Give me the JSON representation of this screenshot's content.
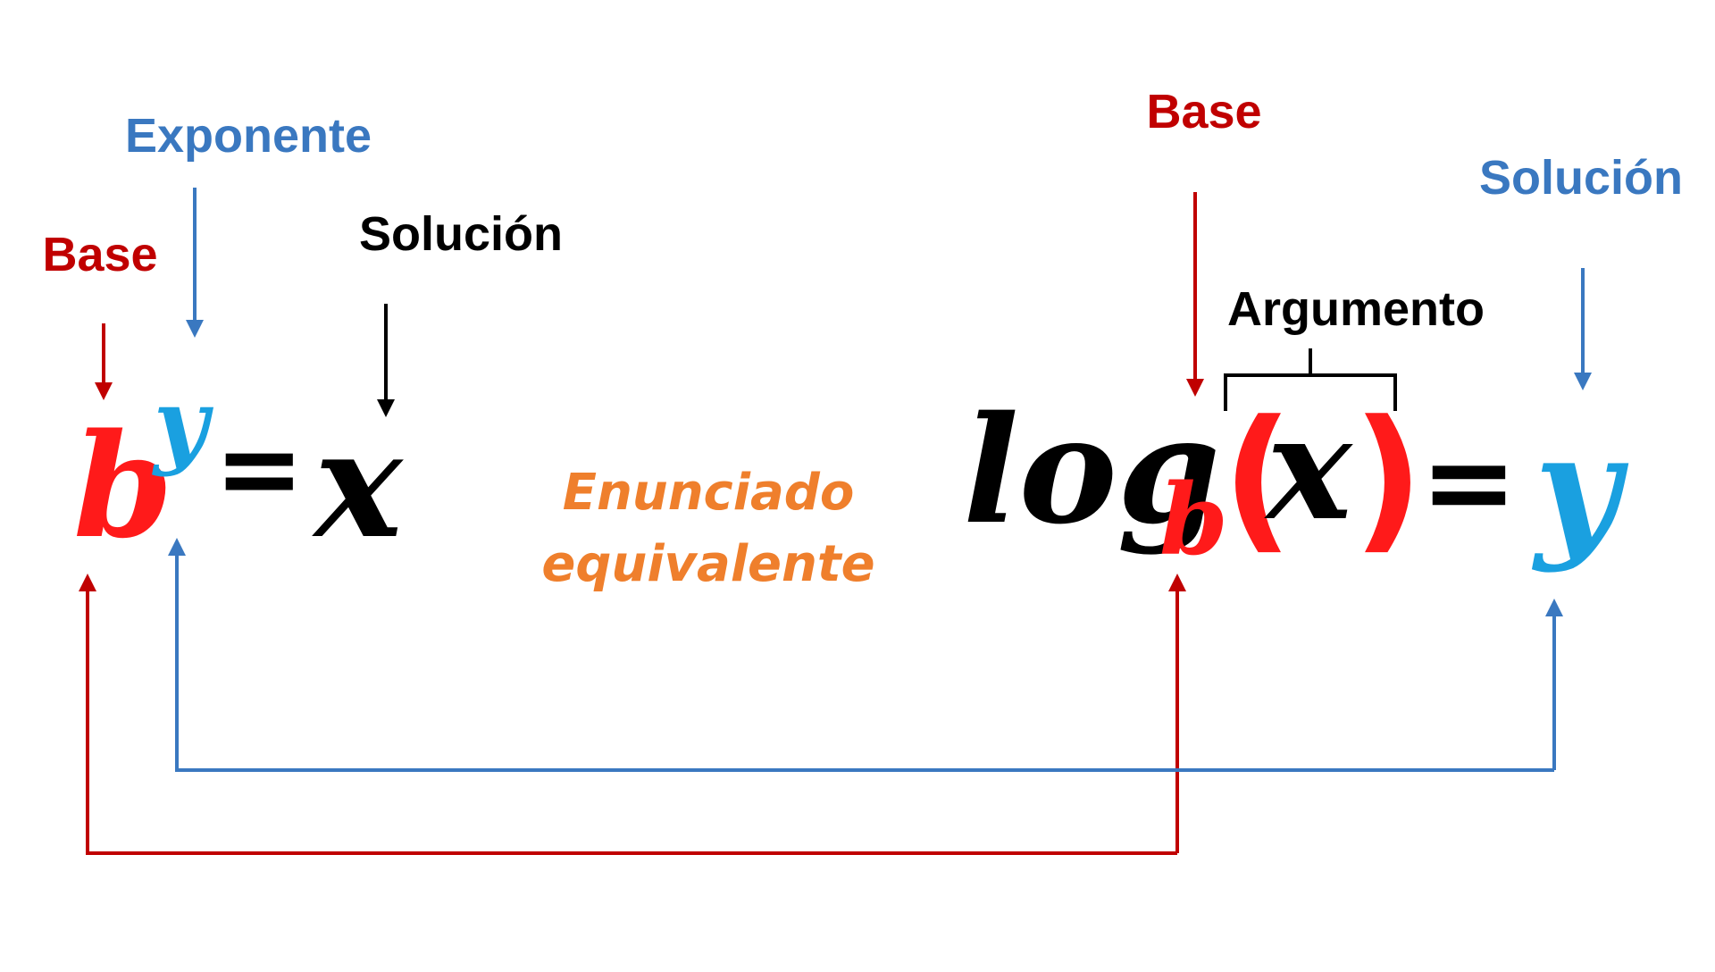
{
  "colors": {
    "red": "#c00000",
    "bright_red": "#ff1a1a",
    "blue": "#3a78c0",
    "cyan": "#1aa0e0",
    "black": "#000000",
    "orange": "#ef7f2c"
  },
  "exponential": {
    "label_base": "Base",
    "label_exponent": "Exponente",
    "label_solution": "Solución",
    "base": "b",
    "exponent": "y",
    "equals": "=",
    "result": "x"
  },
  "middle": {
    "line1": "Enunciado",
    "line2": "equivalente"
  },
  "logarithmic": {
    "label_base": "Base",
    "label_argument": "Argumento",
    "label_solution": "Solución",
    "log": "log",
    "base": "b",
    "open_paren": "(",
    "argument": "x",
    "close_paren": ")",
    "equals": "=",
    "result": "y"
  }
}
